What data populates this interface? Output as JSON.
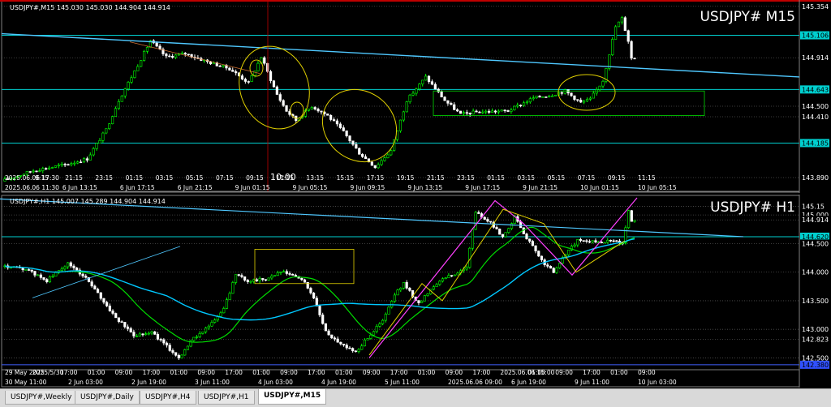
{
  "colors": {
    "bull": "#00ff00",
    "bear": "#ffffff",
    "bidline": "#c0c0c0",
    "trend": "#4fc8ff",
    "hline": "#00cfcf",
    "ma_fast": "#00dd00",
    "ma_slow": "#00c8ff",
    "annot": "#e0d000",
    "zigzag": "#ff40ff",
    "vline": "#c00000"
  },
  "tabs": [
    {
      "label": "USDJPY#,Weekly",
      "active": false
    },
    {
      "label": "USDJPY#,Daily",
      "active": false
    },
    {
      "label": "USDJPY#,H4",
      "active": false
    },
    {
      "label": "USDJPY#,H1",
      "active": false
    },
    {
      "label": "USDJPY#,M15",
      "active": true
    }
  ],
  "chart_data": [
    {
      "type": "candlestick",
      "info": "USDJPY#,M15  145.030 145.030 144.904 144.914",
      "watermark": "USDJPY# M15",
      "ylim": [
        143.8,
        145.38
      ],
      "yticks": [
        "145.354",
        "145.106",
        "144.914",
        "144.643",
        "144.500",
        "144.410",
        "144.185",
        "143.890"
      ],
      "price_tags": [
        {
          "price": 145.354,
          "label": "145.354",
          "style": "plain"
        },
        {
          "price": 145.106,
          "label": "145.106",
          "style": "cyan"
        },
        {
          "price": 144.914,
          "label": "144.914",
          "style": "plain"
        },
        {
          "price": 144.643,
          "label": "144.643",
          "style": "cyan"
        },
        {
          "price": 144.5,
          "label": "144.500",
          "style": "plain"
        },
        {
          "price": 144.41,
          "label": "144.410",
          "style": "plain"
        },
        {
          "price": 144.185,
          "label": "144.185",
          "style": "cyan"
        },
        {
          "price": 143.89,
          "label": "143.890",
          "style": "plain"
        }
      ],
      "xticks": [
        "2025.06.06 17:30",
        "9:15",
        "21:15",
        "23:15",
        "01:15",
        "03:15",
        "05:15",
        "07:15",
        "09:15",
        "11:15",
        "13:15",
        "15:15",
        "17:15",
        "19:15",
        "21:15",
        "23:15",
        "01:15",
        "03:15",
        "05:15",
        "07:15",
        "09:15",
        "11:15"
      ],
      "xticks2": [
        "2025.06.06 11:30",
        "6 Jun 13:15",
        "6 Jun 17:15",
        "6 Jun 21:15",
        "9 Jun 01:15",
        "9 Jun 05:15",
        "9 Jun 09:15",
        "9 Jun 13:15",
        "9 Jun 17:15",
        "9 Jun 21:15",
        "10 Jun 01:15",
        "10 Jun 05:15"
      ],
      "cursor_label": "10:00",
      "anchors": [
        [
          0,
          143.86
        ],
        [
          10,
          143.95
        ],
        [
          20,
          144.0
        ],
        [
          27,
          144.05
        ],
        [
          33,
          144.3
        ],
        [
          37,
          144.55
        ],
        [
          42,
          144.8
        ],
        [
          47,
          145.06
        ],
        [
          52,
          144.92
        ],
        [
          58,
          144.95
        ],
        [
          65,
          144.88
        ],
        [
          72,
          144.82
        ],
        [
          78,
          144.7
        ],
        [
          82,
          144.92
        ],
        [
          87,
          144.6
        ],
        [
          90,
          144.46
        ],
        [
          93,
          144.38
        ],
        [
          98,
          144.5
        ],
        [
          103,
          144.42
        ],
        [
          108,
          144.28
        ],
        [
          113,
          144.1
        ],
        [
          118,
          143.98
        ],
        [
          123,
          144.12
        ],
        [
          128,
          144.55
        ],
        [
          134,
          144.75
        ],
        [
          140,
          144.55
        ],
        [
          145,
          144.43
        ],
        [
          150,
          144.45
        ],
        [
          160,
          144.46
        ],
        [
          168,
          144.57
        ],
        [
          174,
          144.6
        ],
        [
          178,
          144.63
        ],
        [
          183,
          144.53
        ],
        [
          186,
          144.56
        ],
        [
          190,
          144.72
        ],
        [
          194,
          145.18
        ],
        [
          196,
          145.25
        ],
        [
          198,
          145.06
        ],
        [
          199,
          144.91
        ]
      ]
    },
    {
      "type": "candlestick",
      "info": "USDJPY#,H1  145.007 145.289 144.904 144.914",
      "watermark": "USDJPY# H1",
      "ylim": [
        142.35,
        145.3
      ],
      "yticks": [
        "145.000",
        "144.914",
        "144.500",
        "144.000",
        "143.500",
        "143.000",
        "142.823",
        "142.500",
        "142.380"
      ],
      "price_tags": [
        {
          "price": 145.15,
          "label": "145.15",
          "style": "plain"
        },
        {
          "price": 145.0,
          "label": "145.000",
          "style": "plain"
        },
        {
          "price": 144.914,
          "label": "144.914",
          "style": "plain"
        },
        {
          "price": 144.62,
          "label": "144.620",
          "style": "cyan"
        },
        {
          "price": 144.5,
          "label": "144.500",
          "style": "plain"
        },
        {
          "price": 144.0,
          "label": "144.000",
          "style": "plain"
        },
        {
          "price": 143.5,
          "label": "143.500",
          "style": "plain"
        },
        {
          "price": 143.0,
          "label": "143.000",
          "style": "plain"
        },
        {
          "price": 142.823,
          "label": "142.823",
          "style": "plain"
        },
        {
          "price": 142.5,
          "label": "142.500",
          "style": "plain"
        },
        {
          "price": 142.38,
          "label": "142.380",
          "style": "blue"
        }
      ],
      "xticks": [
        "29 May 2025",
        "2025/5/30",
        "17:00",
        "01:00",
        "09:00",
        "17:00",
        "01:00",
        "09:00",
        "17:00",
        "01:00",
        "09:00",
        "17:00",
        "01:00",
        "09:00",
        "17:00",
        "01:00",
        "09:00",
        "17:00",
        "2025.06.06 15:00",
        "01:00",
        "09:00",
        "17:00",
        "01:00",
        "09:00"
      ],
      "xticks2": [
        "30 May 11:00",
        "2 Jun 03:00",
        "2 Jun 19:00",
        "3 Jun 11:00",
        "4 Jun 03:00",
        "4 Jun 19:00",
        "5 Jun 11:00",
        "2025.06.06 09:00",
        "6 Jun 19:00",
        "9 Jun 11:00",
        "10 Jun 03:00"
      ],
      "anchors": [
        [
          0,
          144.1
        ],
        [
          8,
          144.05
        ],
        [
          15,
          143.85
        ],
        [
          22,
          144.15
        ],
        [
          28,
          143.9
        ],
        [
          33,
          143.55
        ],
        [
          38,
          143.2
        ],
        [
          44,
          142.9
        ],
        [
          50,
          142.95
        ],
        [
          55,
          142.7
        ],
        [
          59,
          142.5
        ],
        [
          64,
          142.85
        ],
        [
          70,
          143.1
        ],
        [
          74,
          143.35
        ],
        [
          78,
          143.95
        ],
        [
          82,
          143.85
        ],
        [
          88,
          143.88
        ],
        [
          93,
          144.0
        ],
        [
          97,
          143.95
        ],
        [
          101,
          143.82
        ],
        [
          104,
          143.55
        ],
        [
          108,
          142.95
        ],
        [
          113,
          142.75
        ],
        [
          118,
          142.6
        ],
        [
          123,
          142.92
        ],
        [
          127,
          143.15
        ],
        [
          131,
          143.6
        ],
        [
          134,
          143.8
        ],
        [
          139,
          143.45
        ],
        [
          143,
          143.7
        ],
        [
          147,
          143.9
        ],
        [
          151,
          143.95
        ],
        [
          155,
          144.1
        ],
        [
          158,
          145.05
        ],
        [
          163,
          144.85
        ],
        [
          167,
          144.62
        ],
        [
          171,
          144.95
        ],
        [
          175,
          144.6
        ],
        [
          180,
          144.2
        ],
        [
          184,
          144.0
        ],
        [
          188,
          144.32
        ],
        [
          192,
          144.55
        ],
        [
          198,
          144.53
        ],
        [
          203,
          144.55
        ],
        [
          207,
          144.5
        ],
        [
          209,
          145.1
        ],
        [
          210,
          144.91
        ]
      ]
    }
  ]
}
